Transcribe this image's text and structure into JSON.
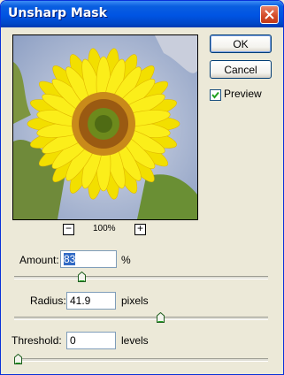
{
  "window": {
    "title": "Unsharp Mask"
  },
  "buttons": {
    "ok": "OK",
    "cancel": "Cancel"
  },
  "preview_checkbox": {
    "label": "Preview",
    "checked": true
  },
  "zoom": {
    "level": "100%",
    "minus": "−",
    "plus": "+"
  },
  "amount": {
    "label": "Amount:",
    "value": "83",
    "unit": "%",
    "slider_fraction": 0.26
  },
  "radius": {
    "label": "Radius:",
    "value": "41.9",
    "unit": "pixels",
    "slider_fraction": 0.58
  },
  "threshold": {
    "label": "Threshold:",
    "value": "0",
    "unit": "levels",
    "slider_fraction": 0.0
  }
}
